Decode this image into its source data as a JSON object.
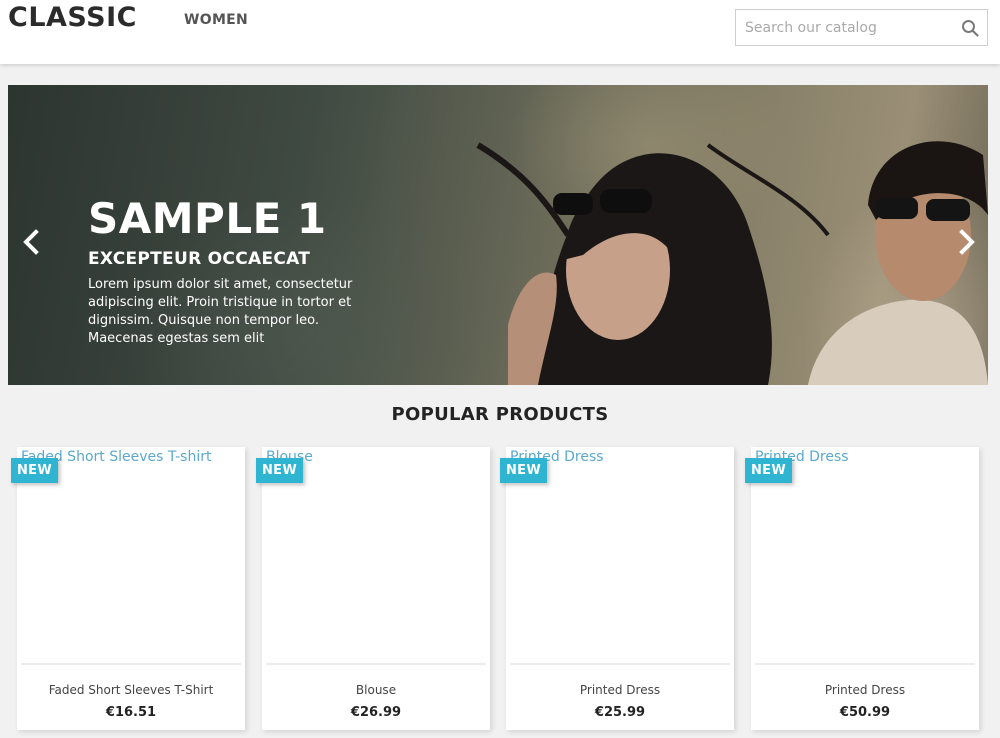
{
  "header": {
    "logo": "CLASSIC",
    "nav": [
      {
        "label": "WOMEN"
      }
    ],
    "search": {
      "placeholder": "Search our catalog",
      "value": ""
    }
  },
  "hero": {
    "title": "SAMPLE 1",
    "subtitle": "EXCEPTEUR OCCAECAT",
    "text": "Lorem ipsum dolor sit amet, consectetur adipiscing elit. Proin tristique in tortor et dignissim. Quisque non tempor leo. Maecenas egestas sem elit"
  },
  "section": {
    "title": "POPULAR PRODUCTS"
  },
  "products": [
    {
      "image_alt": "Faded Short Sleeves T-shirt",
      "badge": "NEW",
      "name": "Faded Short Sleeves T-Shirt",
      "price": "€16.51"
    },
    {
      "image_alt": "Blouse",
      "badge": "NEW",
      "name": "Blouse",
      "price": "€26.99"
    },
    {
      "image_alt": "Printed Dress",
      "badge": "NEW",
      "name": "Printed Dress",
      "price": "€25.99"
    },
    {
      "image_alt": "Printed Dress",
      "badge": "NEW",
      "name": "Printed Dress",
      "price": "€50.99"
    }
  ],
  "colors": {
    "accent": "#2fb5d2",
    "link": "#5ba9cd",
    "header_bg": "#ffffff",
    "page_bg": "#f1f1f1",
    "text_dark": "#232323"
  },
  "icons": {
    "search": "search-icon",
    "prev": "chevron-left-icon",
    "next": "chevron-right-icon"
  }
}
